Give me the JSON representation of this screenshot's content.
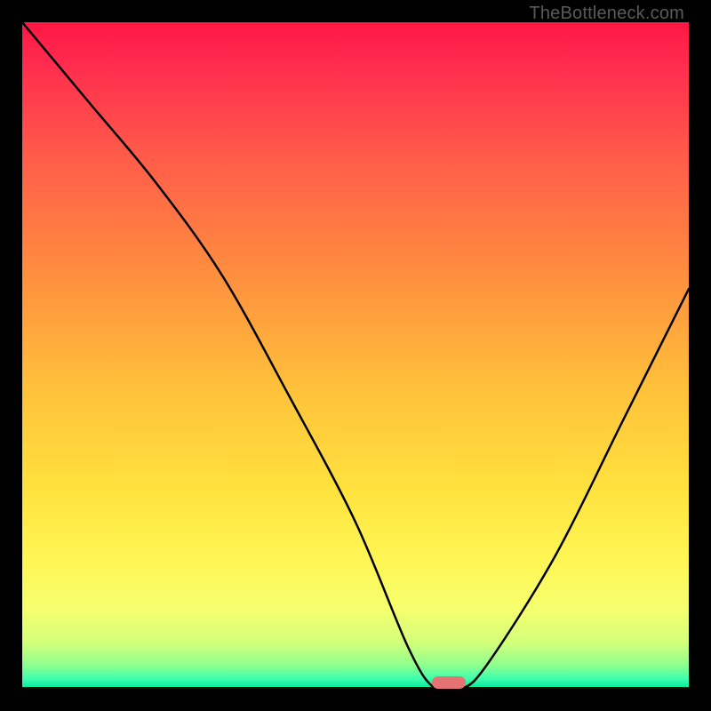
{
  "watermark": "TheBottleneck.com",
  "chart_data": {
    "type": "line",
    "title": "",
    "xlabel": "",
    "ylabel": "",
    "xlim": [
      0,
      100
    ],
    "ylim": [
      0,
      100
    ],
    "series": [
      {
        "name": "bottleneck-curve",
        "x": [
          0,
          10,
          20,
          30,
          40,
          50,
          58,
          62,
          66,
          70,
          80,
          90,
          100
        ],
        "y": [
          100,
          88,
          76,
          62,
          44,
          25,
          6,
          0,
          0,
          4,
          20,
          40,
          60
        ]
      }
    ],
    "marker": {
      "x": 64,
      "y": 1
    },
    "gradient_stops": [
      {
        "pos": 0.0,
        "color": "#ff1744"
      },
      {
        "pos": 0.06,
        "color": "#ff2b4e"
      },
      {
        "pos": 0.2,
        "color": "#ff5b4a"
      },
      {
        "pos": 0.38,
        "color": "#ff8f3e"
      },
      {
        "pos": 0.55,
        "color": "#ffc13a"
      },
      {
        "pos": 0.7,
        "color": "#ffe23e"
      },
      {
        "pos": 0.8,
        "color": "#fff552"
      },
      {
        "pos": 0.88,
        "color": "#f6ff6e"
      },
      {
        "pos": 0.93,
        "color": "#d4ff7a"
      },
      {
        "pos": 0.965,
        "color": "#8eff8e"
      },
      {
        "pos": 0.985,
        "color": "#3dffad"
      },
      {
        "pos": 1.0,
        "color": "#00e79a"
      }
    ]
  }
}
